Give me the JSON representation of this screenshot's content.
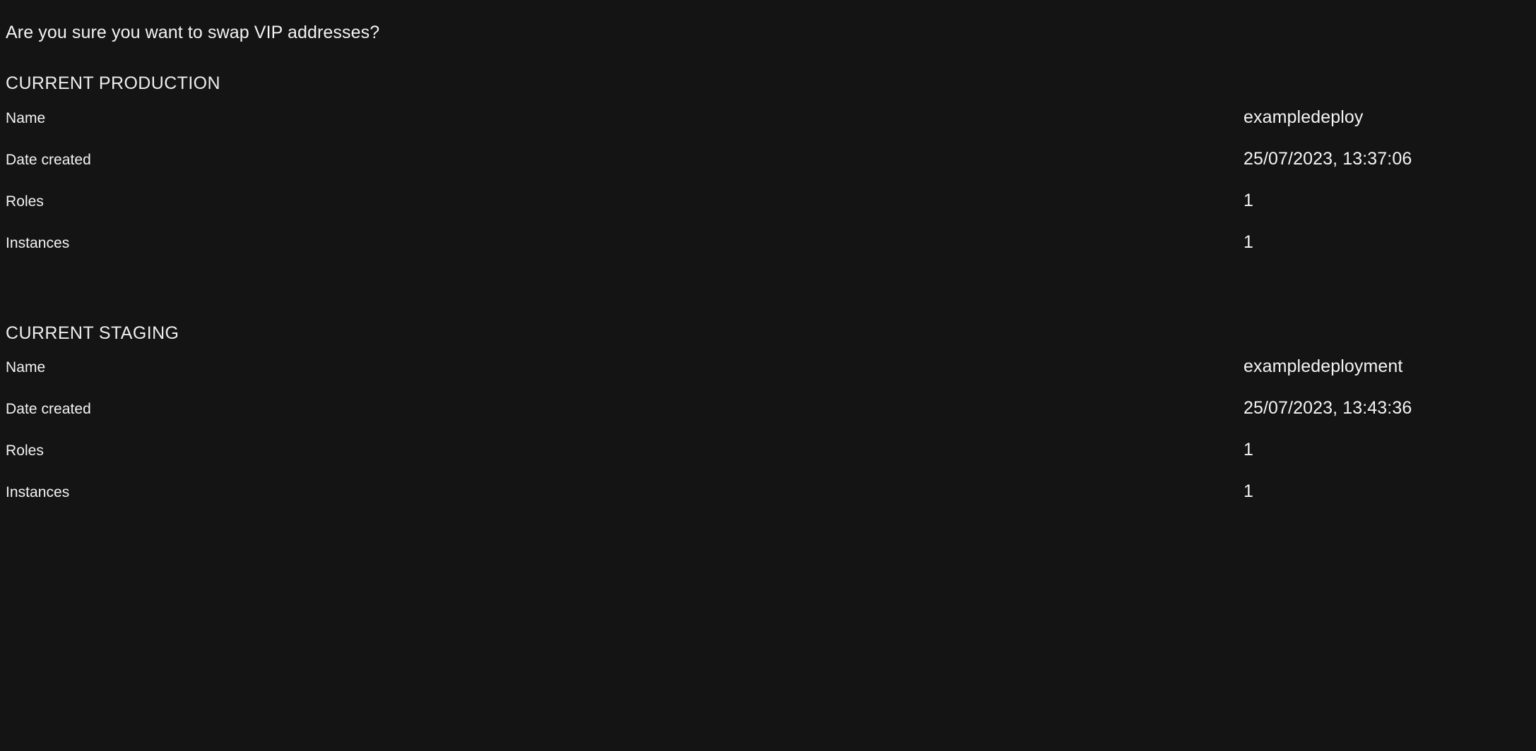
{
  "dialog": {
    "question": "Are you sure you want to swap VIP addresses?"
  },
  "sections": {
    "production": {
      "heading": "CURRENT PRODUCTION",
      "rows": [
        {
          "label": "Name",
          "value": "exampledeploy"
        },
        {
          "label": "Date created",
          "value": "25/07/2023, 13:37:06"
        },
        {
          "label": "Roles",
          "value": "1"
        },
        {
          "label": "Instances",
          "value": "1"
        }
      ]
    },
    "staging": {
      "heading": "CURRENT STAGING",
      "rows": [
        {
          "label": "Name",
          "value": "exampledeployment"
        },
        {
          "label": "Date created",
          "value": "25/07/2023, 13:43:36"
        },
        {
          "label": "Roles",
          "value": "1"
        },
        {
          "label": "Instances",
          "value": "1"
        }
      ]
    }
  },
  "colors": {
    "background": "#141414",
    "text": "#f3f3f3",
    "heading": "#eeeeee"
  }
}
